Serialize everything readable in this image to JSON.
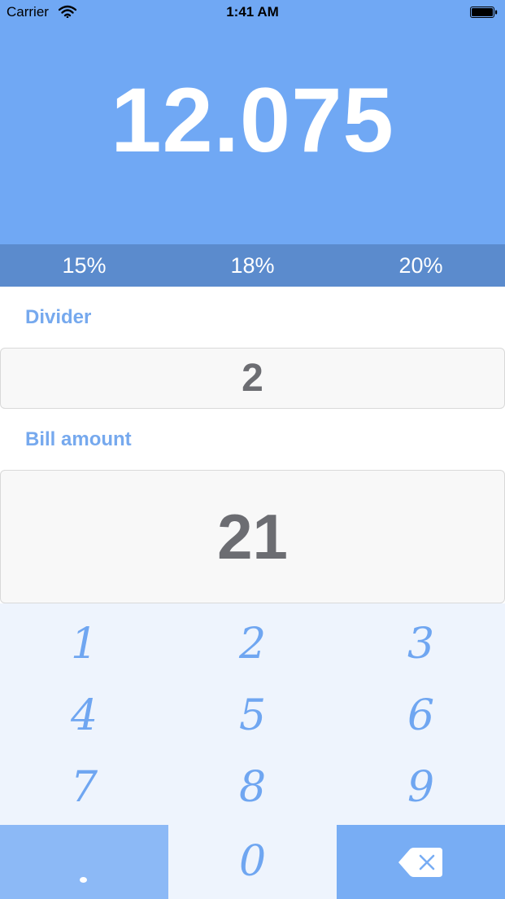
{
  "status_bar": {
    "carrier": "Carrier",
    "time": "1:41 AM"
  },
  "result": "12.075",
  "tip_options": [
    "15%",
    "18%",
    "20%"
  ],
  "divider": {
    "label": "Divider",
    "value": "2"
  },
  "bill": {
    "label": "Bill amount",
    "value": "21"
  },
  "keypad": {
    "keys": [
      "1",
      "2",
      "3",
      "4",
      "5",
      "6",
      "7",
      "8",
      "9"
    ],
    "zero": "0",
    "backspace_icon": "backspace-icon"
  },
  "colors": {
    "header": "#70a8f4",
    "percent_bar": "#5b8bcd",
    "label": "#76a9ee",
    "keypad_bg": "#eef4fd",
    "key_text": "#6fa6f1",
    "dot_key": "#8cb9f6",
    "backspace_key": "#78adf4"
  }
}
